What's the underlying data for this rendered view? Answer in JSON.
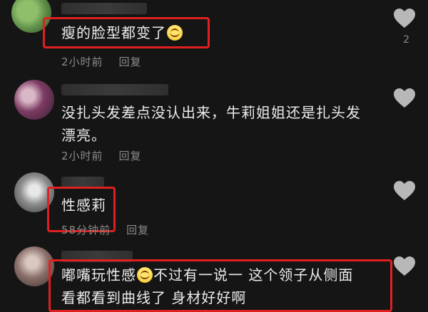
{
  "comments": [
    {
      "text": "瘦的脸型都变了",
      "emoji": "laughing-emoji",
      "time": "2小时前",
      "reply": "回复",
      "likes": "2"
    },
    {
      "text_line1": "没扎头发差点没认出来，牛莉姐姐还是扎头发",
      "text_line2": "漂亮。",
      "time": "2小时前",
      "reply": "回复"
    },
    {
      "text": "性感莉",
      "time": "58分钟前",
      "reply": "回复"
    },
    {
      "text_part1": "嘟嘴玩性感",
      "emoji": "laughing-emoji",
      "text_part2": "不过有一说一 这个领子从侧面",
      "text_line2": "看都看到曲线了 身材好好啊"
    }
  ],
  "colors": {
    "highlight": "#e02020",
    "background": "#151515",
    "meta": "#8a8a8a"
  }
}
